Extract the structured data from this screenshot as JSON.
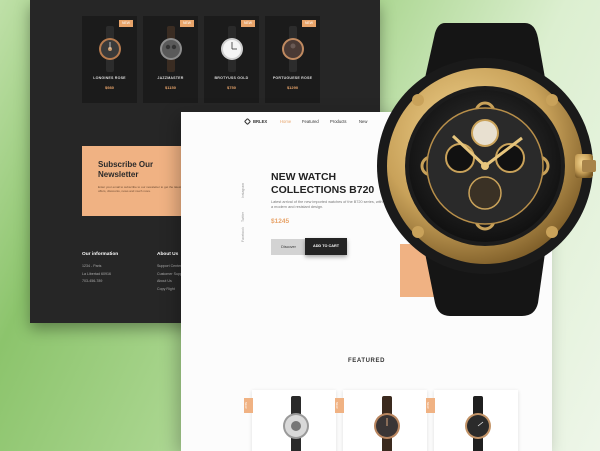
{
  "back_page": {
    "products": [
      {
        "name": "LONGINES ROSE",
        "price": "$980",
        "badge": "NEW"
      },
      {
        "name": "JAZZMASTER",
        "price": "$1150",
        "badge": "NEW"
      },
      {
        "name": "BROTYUSS GOLD",
        "price": "$750",
        "badge": "NEW"
      },
      {
        "name": "PORTUGUESE ROSE",
        "price": "$1290",
        "badge": "NEW"
      }
    ],
    "newsletter": {
      "title": "Subscribe Our Newsletter",
      "text": "Enter your email to subscribe to our newsletter to get the latest offers, discounts, news and much more."
    },
    "footer": {
      "info_title": "Our information",
      "info_lines": [
        "1234 - Paris",
        "La Libertad 60916",
        "703-456-789"
      ],
      "about_title": "About Us",
      "about_lines": [
        "Support Center",
        "Customer Support",
        "About Us",
        "Copy Right"
      ]
    }
  },
  "front_page": {
    "logo": "BRLEX",
    "nav": [
      "Home",
      "Featured",
      "Products",
      "New"
    ],
    "socials": [
      "Instagram",
      "Twitter",
      "Facebook"
    ],
    "hero": {
      "title_line1": "NEW WATCH",
      "title_line2": "COLLECTIONS B720",
      "description": "Latest arrival of the new imported watches of the B720 series, with a modern and resistant design.",
      "price": "$1245",
      "discover_label": "Discover",
      "cart_label": "ADD TO CART"
    },
    "featured_title": "FEATURED",
    "featured_badges": [
      "NEW",
      "NEW",
      "NEW"
    ]
  },
  "colors": {
    "accent": "#e8a46a",
    "dark_bg": "#262626",
    "gold": "#c9a25a"
  },
  "icons": [
    "logo-diamond-icon"
  ]
}
